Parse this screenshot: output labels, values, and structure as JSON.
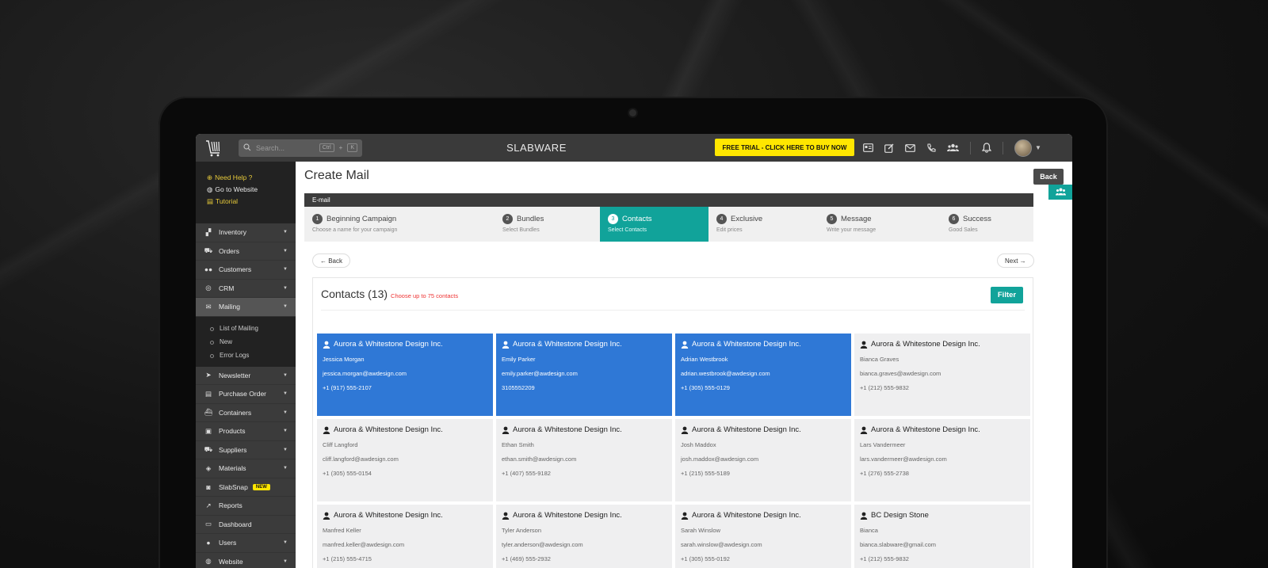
{
  "app": {
    "brand": "SLABWARE",
    "search_placeholder": "Search...",
    "search_kbd_1": "Ctrl",
    "search_kbd_sep": "+",
    "search_kbd_2": "K",
    "trial_label": "FREE TRIAL - CLICK HERE TO BUY NOW"
  },
  "help": {
    "need_help": "Need Help ?",
    "go_to_website": "Go to Website",
    "tutorial": "Tutorial"
  },
  "sidebar": {
    "items": [
      {
        "label": "Inventory",
        "icon": "boxes-icon"
      },
      {
        "label": "Orders",
        "icon": "cart-icon"
      },
      {
        "label": "Customers",
        "icon": "users-icon"
      },
      {
        "label": "CRM",
        "icon": "target-icon"
      },
      {
        "label": "Mailing",
        "icon": "envelope-icon"
      }
    ],
    "sub_items": [
      "List of Mailing",
      "New",
      "Error Logs"
    ],
    "items_after": [
      {
        "label": "Newsletter",
        "icon": "paper-plane-icon"
      },
      {
        "label": "Purchase Order",
        "icon": "document-icon"
      },
      {
        "label": "Containers",
        "icon": "container-icon"
      },
      {
        "label": "Products",
        "icon": "product-box-icon"
      },
      {
        "label": "Suppliers",
        "icon": "truck-icon"
      },
      {
        "label": "Materials",
        "icon": "cube-icon"
      },
      {
        "label": "SlabSnap",
        "icon": "camera-icon",
        "badge": "NEW"
      },
      {
        "label": "Reports",
        "icon": "chart-line-icon"
      },
      {
        "label": "Dashboard",
        "icon": "laptop-icon"
      },
      {
        "label": "Users",
        "icon": "user-icon"
      },
      {
        "label": "Website",
        "icon": "globe-icon"
      }
    ]
  },
  "main": {
    "title": "Create Mail",
    "back_label": "Back",
    "section_label": "E-mail",
    "steps": [
      {
        "num": "1",
        "title": "Beginning Campaign",
        "sub": "Choose a name for your campaign"
      },
      {
        "num": "2",
        "title": "Bundles",
        "sub": "Select Bundles"
      },
      {
        "num": "3",
        "title": "Contacts",
        "sub": "Select Contacts"
      },
      {
        "num": "4",
        "title": "Exclusive",
        "sub": "Edit prices"
      },
      {
        "num": "5",
        "title": "Message",
        "sub": "Write your message"
      },
      {
        "num": "6",
        "title": "Success",
        "sub": "Good Sales"
      }
    ],
    "prev_label": "← Back",
    "next_label": "Next →",
    "contacts_title": "Contacts (13)",
    "contacts_note": "Choose up to 75 contacts",
    "filter_label": "Filter"
  },
  "contacts": [
    {
      "company": "Aurora & Whitestone Design Inc.",
      "name": "Jessica Morgan",
      "email": "jessica.morgan@awdesign.com",
      "phone": "+1 (917) 555-2107",
      "selected": true
    },
    {
      "company": "Aurora & Whitestone Design Inc.",
      "name": "Emily Parker",
      "email": "emily.parker@awdesign.com",
      "phone": "3105552209",
      "selected": true
    },
    {
      "company": "Aurora & Whitestone Design Inc.",
      "name": "Adrian Westbrook",
      "email": "adrian.westbrook@awdesign.com",
      "phone": "+1 (305) 555-0129",
      "selected": true
    },
    {
      "company": "Aurora & Whitestone Design Inc.",
      "name": "Bianca Graves",
      "email": "bianca.graves@awdesign.com",
      "phone": "+1 (212) 555-9832",
      "selected": false
    },
    {
      "company": "Aurora & Whitestone Design Inc.",
      "name": "Cliff Langford",
      "email": "cliff.langford@awdesign.com",
      "phone": "+1 (305) 555-0154",
      "selected": false
    },
    {
      "company": "Aurora & Whitestone Design Inc.",
      "name": "Ethan Smith",
      "email": "ethan.smith@awdesign.com",
      "phone": "+1 (407) 555-9182",
      "selected": false
    },
    {
      "company": "Aurora & Whitestone Design Inc.",
      "name": "Josh Maddox",
      "email": "josh.maddox@awdesign.com",
      "phone": "+1 (215) 555-5189",
      "selected": false
    },
    {
      "company": "Aurora & Whitestone Design Inc.",
      "name": "Lars Vandermeer",
      "email": "lars.vandermeer@awdesign.com",
      "phone": "+1 (276) 555-2738",
      "selected": false
    },
    {
      "company": "Aurora & Whitestone Design Inc.",
      "name": "Manfred Keller",
      "email": "manfred.keller@awdesign.com",
      "phone": "+1 (215) 555-4715",
      "selected": false
    },
    {
      "company": "Aurora & Whitestone Design Inc.",
      "name": "Tyler Anderson",
      "email": "tyler.anderson@awdesign.com",
      "phone": "+1 (469) 555-2932",
      "selected": false
    },
    {
      "company": "Aurora & Whitestone Design Inc.",
      "name": "Sarah Winslow",
      "email": "sarah.winslow@awdesign.com",
      "phone": "+1 (305) 555-0192",
      "selected": false
    },
    {
      "company": "BC Design Stone",
      "name": "Bianca",
      "email": "bianca.slabware@gmail.com",
      "phone": "+1 (212) 555-9832",
      "selected": false
    }
  ],
  "colors": {
    "accent": "#11a39a",
    "selected_card": "#2f78d6",
    "trial": "#ffe600",
    "help_link": "#e6c93a"
  }
}
